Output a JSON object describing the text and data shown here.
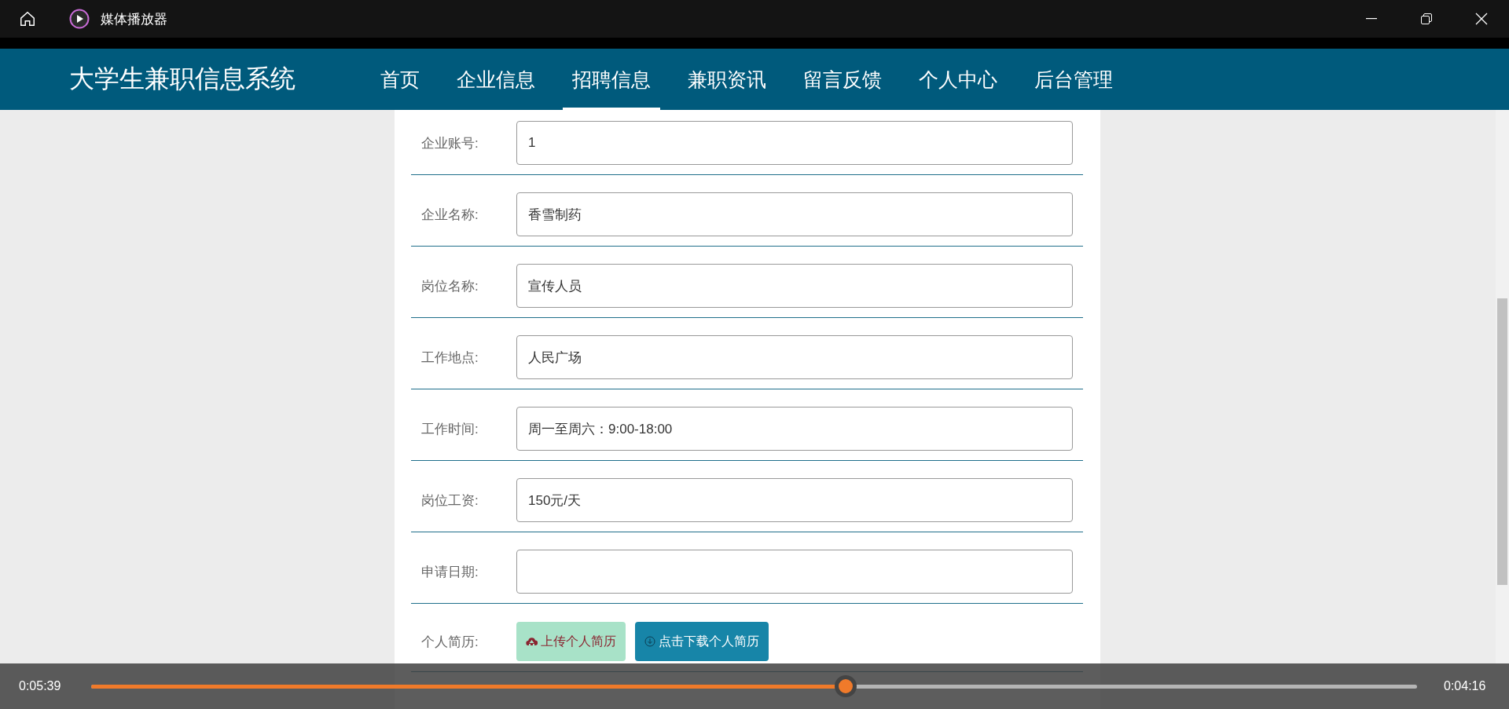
{
  "window": {
    "title": "媒体播放器"
  },
  "site": {
    "brand": "大学生兼职信息系统",
    "nav": [
      {
        "label": "首页",
        "selected": false
      },
      {
        "label": "企业信息",
        "selected": false
      },
      {
        "label": "招聘信息",
        "selected": true
      },
      {
        "label": "兼职资讯",
        "selected": false
      },
      {
        "label": "留言反馈",
        "selected": false
      },
      {
        "label": "个人中心",
        "selected": false
      },
      {
        "label": "后台管理",
        "selected": false
      }
    ],
    "form": [
      {
        "kind": "text",
        "label": "企业账号:",
        "value": "1"
      },
      {
        "kind": "text",
        "label": "企业名称:",
        "value": "香雪制药"
      },
      {
        "kind": "text",
        "label": "岗位名称:",
        "value": "宣传人员"
      },
      {
        "kind": "text",
        "label": "工作地点:",
        "value": "人民广场"
      },
      {
        "kind": "text",
        "label": "工作时间:",
        "value": "周一至周六：9:00-18:00"
      },
      {
        "kind": "text",
        "label": "岗位工资:",
        "value": "150元/天"
      },
      {
        "kind": "text",
        "label": "申请日期:"
      },
      {
        "kind": "files",
        "label": "个人简历:",
        "upload": "上传个人简历",
        "download": "点击下载个人简历"
      }
    ]
  },
  "player": {
    "elapsed": "0:05:39",
    "remaining": "0:04:16",
    "level": 0.569
  }
}
